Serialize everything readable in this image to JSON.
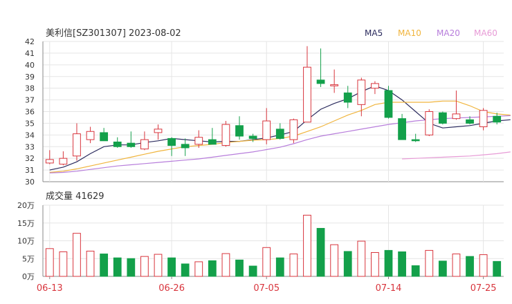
{
  "header": {
    "title": "美利信[SZ301307] 2023-08-02",
    "ma_labels": [
      {
        "label": "MA5",
        "color": "#2b2b5e"
      },
      {
        "label": "MA10",
        "color": "#f0b43c"
      },
      {
        "label": "MA20",
        "color": "#b77ddb"
      },
      {
        "label": "MA60",
        "color": "#e79ad6"
      }
    ]
  },
  "volume_header": {
    "label": "成交量 41629"
  },
  "colors": {
    "up": "#d8343c",
    "down": "#13a04a",
    "grid": "#e5e5e5",
    "axis": "#888888",
    "date_text": "#d8343c"
  },
  "chart_data": [
    {
      "type": "candlestick",
      "title": "美利信[SZ301307] 2023-08-02",
      "ylim": [
        30,
        42
      ],
      "y_ticks": [
        "42",
        "41",
        "40",
        "39",
        "38",
        "37",
        "36",
        "35",
        "34",
        "33",
        "32",
        "31",
        "30"
      ],
      "x_tick_labels": [
        {
          "label": "06-13",
          "index": 0
        },
        {
          "label": "06-26",
          "index": 9
        },
        {
          "label": "07-05",
          "index": 16
        },
        {
          "label": "07-14",
          "index": 25
        },
        {
          "label": "07-25",
          "index": 32
        }
      ],
      "candles": [
        {
          "o": 31.6,
          "h": 32.7,
          "l": 31.5,
          "c": 31.9
        },
        {
          "o": 31.5,
          "h": 32.6,
          "l": 31.4,
          "c": 32.0
        },
        {
          "o": 32.2,
          "h": 35.0,
          "l": 31.8,
          "c": 34.1
        },
        {
          "o": 33.6,
          "h": 34.7,
          "l": 33.3,
          "c": 34.3
        },
        {
          "o": 34.2,
          "h": 34.6,
          "l": 33.5,
          "c": 33.5
        },
        {
          "o": 33.4,
          "h": 33.8,
          "l": 32.9,
          "c": 33.0
        },
        {
          "o": 33.3,
          "h": 34.3,
          "l": 32.9,
          "c": 33.0
        },
        {
          "o": 32.8,
          "h": 34.3,
          "l": 32.7,
          "c": 33.6
        },
        {
          "o": 34.2,
          "h": 34.9,
          "l": 33.6,
          "c": 34.5
        },
        {
          "o": 33.7,
          "h": 33.8,
          "l": 32.2,
          "c": 33.1
        },
        {
          "o": 33.2,
          "h": 33.7,
          "l": 32.2,
          "c": 32.9
        },
        {
          "o": 33.2,
          "h": 34.4,
          "l": 32.9,
          "c": 33.8
        },
        {
          "o": 33.6,
          "h": 34.6,
          "l": 33.2,
          "c": 33.2
        },
        {
          "o": 33.1,
          "h": 35.2,
          "l": 33.0,
          "c": 34.9
        },
        {
          "o": 34.8,
          "h": 35.6,
          "l": 33.6,
          "c": 33.9
        },
        {
          "o": 33.9,
          "h": 34.1,
          "l": 33.4,
          "c": 33.7
        },
        {
          "o": 33.6,
          "h": 36.3,
          "l": 33.2,
          "c": 35.2
        },
        {
          "o": 34.5,
          "h": 35.0,
          "l": 33.6,
          "c": 33.7
        },
        {
          "o": 33.6,
          "h": 35.4,
          "l": 33.3,
          "c": 35.3
        },
        {
          "o": 35.1,
          "h": 41.6,
          "l": 35.1,
          "c": 39.8
        },
        {
          "o": 38.7,
          "h": 41.4,
          "l": 38.1,
          "c": 38.4
        },
        {
          "o": 38.2,
          "h": 39.6,
          "l": 37.6,
          "c": 38.3
        },
        {
          "o": 37.6,
          "h": 38.2,
          "l": 36.3,
          "c": 36.8
        },
        {
          "o": 36.6,
          "h": 38.9,
          "l": 35.6,
          "c": 38.7
        },
        {
          "o": 38.0,
          "h": 38.6,
          "l": 37.5,
          "c": 38.4
        },
        {
          "o": 37.8,
          "h": 38.2,
          "l": 35.4,
          "c": 35.5
        },
        {
          "o": 35.4,
          "h": 35.8,
          "l": 33.6,
          "c": 33.6
        },
        {
          "o": 33.6,
          "h": 34.1,
          "l": 33.4,
          "c": 33.5
        },
        {
          "o": 34.0,
          "h": 36.2,
          "l": 33.9,
          "c": 36.0
        },
        {
          "o": 35.9,
          "h": 36.0,
          "l": 34.9,
          "c": 35.0
        },
        {
          "o": 35.4,
          "h": 37.8,
          "l": 35.3,
          "c": 35.8
        },
        {
          "o": 35.3,
          "h": 35.6,
          "l": 34.9,
          "c": 35.0
        },
        {
          "o": 34.7,
          "h": 36.3,
          "l": 34.4,
          "c": 36.1
        },
        {
          "o": 35.6,
          "h": 35.9,
          "l": 34.9,
          "c": 35.1
        }
      ],
      "ma": [
        {
          "name": "MA5",
          "start": 0,
          "values": [
            31.0,
            31.25,
            31.7,
            32.4,
            33.0,
            33.15,
            33.15,
            33.35,
            33.5,
            33.7,
            33.6,
            33.5,
            33.4,
            33.45,
            33.45,
            33.6,
            33.75,
            34.0,
            34.3,
            35.3,
            36.2,
            36.7,
            37.1,
            37.7,
            38.2,
            37.8,
            37.0,
            36.0,
            35.0,
            34.6,
            34.7,
            34.8,
            35.0,
            35.2,
            35.3
          ]
        },
        {
          "name": "MA10",
          "start": 0,
          "values": [
            30.8,
            30.9,
            31.1,
            31.35,
            31.6,
            31.85,
            32.1,
            32.35,
            32.6,
            32.8,
            33.0,
            33.1,
            33.2,
            33.35,
            33.45,
            33.55,
            33.6,
            33.7,
            33.9,
            34.3,
            34.7,
            35.2,
            35.7,
            36.1,
            36.6,
            36.8,
            36.8,
            36.8,
            36.8,
            36.9,
            36.9,
            36.5,
            36.0,
            35.8,
            35.7
          ]
        },
        {
          "name": "MA20",
          "start": 0,
          "values": [
            30.75,
            30.8,
            30.9,
            31.05,
            31.2,
            31.35,
            31.45,
            31.55,
            31.65,
            31.75,
            31.85,
            31.95,
            32.1,
            32.25,
            32.4,
            32.55,
            32.75,
            32.95,
            33.25,
            33.6,
            33.9,
            34.1,
            34.3,
            34.5,
            34.7,
            34.9,
            35.05,
            35.2,
            35.3,
            35.4,
            35.45,
            35.5,
            35.55,
            35.6,
            35.65
          ]
        },
        {
          "name": "MA60",
          "start": 26,
          "values": [
            31.95,
            32.0,
            32.05,
            32.1,
            32.15,
            32.2,
            32.3,
            32.4,
            32.55
          ]
        }
      ]
    },
    {
      "type": "bar",
      "title": "成交量 41629",
      "ylim": [
        0,
        20
      ],
      "y_ticks": [
        "20万",
        "15万",
        "10万",
        "5万",
        "0万"
      ],
      "values": [
        7.8,
        6.9,
        12.1,
        7.1,
        6.3,
        5.2,
        5.0,
        5.6,
        6.2,
        5.2,
        3.5,
        4.1,
        4.4,
        6.4,
        4.6,
        2.9,
        8.1,
        5.2,
        6.3,
        17.2,
        13.5,
        8.9,
        7.0,
        9.9,
        6.7,
        7.3,
        6.9,
        3.0,
        7.3,
        4.3,
        6.3,
        5.6,
        6.1,
        4.2
      ]
    }
  ]
}
